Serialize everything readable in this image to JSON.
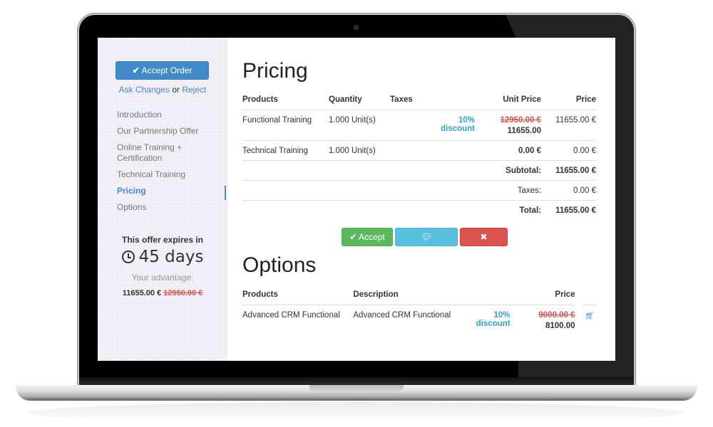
{
  "sidebar": {
    "accept_order_label": "Accept Order",
    "ask_changes_label": "Ask Changes",
    "or_label": "or",
    "reject_label": "Reject",
    "nav_items": [
      {
        "label": "Introduction",
        "active": false
      },
      {
        "label": "Our Partnership Offer",
        "active": false
      },
      {
        "label": "Online Training + Certification",
        "active": false
      },
      {
        "label": "Technical Training",
        "active": false
      },
      {
        "label": "Pricing",
        "active": true
      },
      {
        "label": "Options",
        "active": false
      }
    ],
    "expiry_label": "This offer expires in",
    "expiry_value": "45 days",
    "advantage_label": "Your advantage:",
    "advantage_price": "11655.00 €",
    "advantage_original": "12950.00 €"
  },
  "pricing": {
    "title": "Pricing",
    "headers": {
      "products": "Products",
      "quantity": "Quantity",
      "taxes": "Taxes",
      "unit_price": "Unit Price",
      "price": "Price"
    },
    "rows": [
      {
        "product": "Functional Training",
        "quantity": "1.000 Unit(s)",
        "taxes": "",
        "discount": "10% discount",
        "unit_price_original": "12950.00 €",
        "unit_price": "11655.00",
        "price": "11655.00 €"
      },
      {
        "product": "Technical Training",
        "quantity": "1.000 Unit(s)",
        "taxes": "",
        "discount": "",
        "unit_price_original": "",
        "unit_price": "0.00 €",
        "price": "0.00 €"
      }
    ],
    "subtotal_label": "Subtotal:",
    "subtotal_value": "11655.00 €",
    "taxes_label": "Taxes:",
    "taxes_value": "0.00 €",
    "total_label": "Total:",
    "total_value": "11655.00 €"
  },
  "actions": {
    "accept_label": "Accept",
    "feedback_label": "Feedback",
    "reject_label": "Reject"
  },
  "options": {
    "title": "Options",
    "headers": {
      "products": "Products",
      "description": "Description",
      "price": "Price"
    },
    "rows": [
      {
        "product": "Advanced CRM Functional",
        "description": "Advanced CRM Functional",
        "discount": "10% discount",
        "price_original": "9000.00 €",
        "price": "8100.00"
      }
    ]
  },
  "colors": {
    "primary": "#428bca",
    "success": "#5cb85c",
    "info": "#5bc0de",
    "danger": "#d9534f",
    "discount": "#31a0c9"
  }
}
